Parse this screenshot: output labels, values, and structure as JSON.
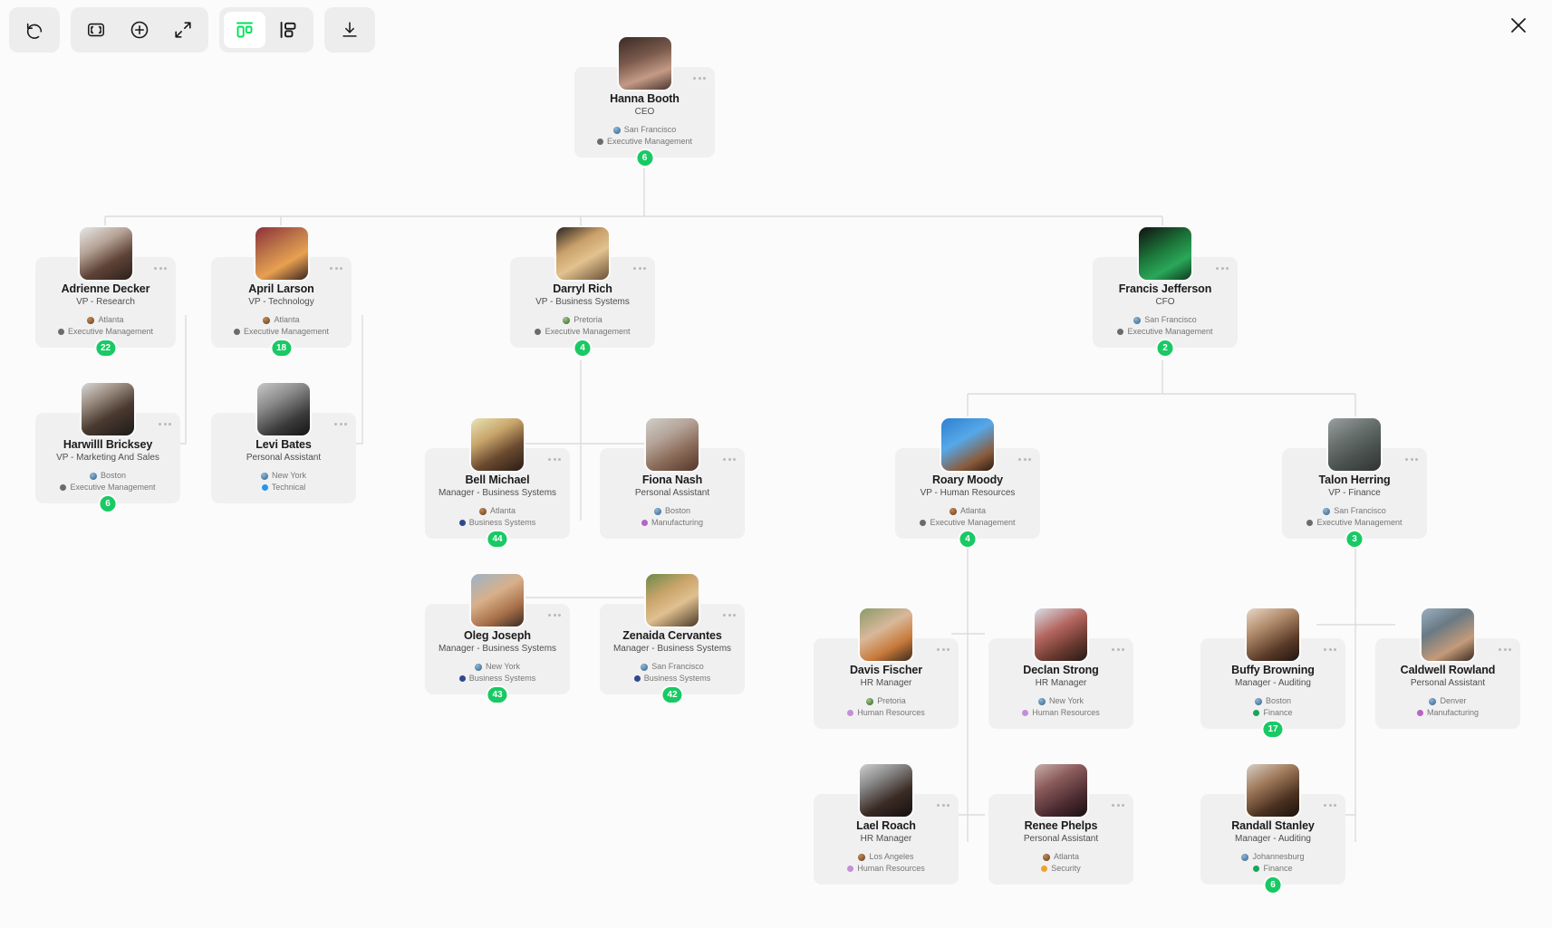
{
  "toolbar": {
    "buttons": [
      {
        "name": "undo-button",
        "icon": "undo-icon",
        "label": "Undo"
      },
      {
        "name": "fit-to-screen-button",
        "icon": "fit-screen-icon",
        "label": "Fit to screen"
      },
      {
        "name": "zoom-in-button",
        "icon": "plus-circle-icon",
        "label": "Zoom in"
      },
      {
        "name": "expand-button",
        "icon": "expand-arrows-icon",
        "label": "Expand"
      },
      {
        "name": "layout-vertical-button",
        "icon": "layout-vertical-icon",
        "label": "Vertical layout",
        "active": true
      },
      {
        "name": "layout-horizontal-button",
        "icon": "layout-horizontal-icon",
        "label": "Horizontal layout",
        "active": false
      },
      {
        "name": "export-button",
        "icon": "download-icon",
        "label": "Export"
      }
    ],
    "close_label": "Close",
    "active_color": "#00e05a"
  },
  "chart": {
    "badge_color": "#18c964",
    "card_bg": "#f0f0f0",
    "canvas_bg": "#fbfbfb"
  },
  "nodes": [
    {
      "id": "hanna-booth",
      "name": "Hanna Booth",
      "title": "CEO",
      "location": "San Francisco",
      "department": "Executive Management",
      "dept_color": "#6b6b6b",
      "globe": "blue",
      "badge": "6",
      "avatar": "linear-gradient(160deg,#3a2a26 0%,#7a5a4c 40%,#c49a86 70%,#4a3530 100%)"
    },
    {
      "id": "adrienne-decker",
      "name": "Adrienne Decker",
      "title": "VP - Research",
      "location": "Atlanta",
      "department": "Executive Management",
      "dept_color": "#6b6b6b",
      "globe": "amber",
      "badge": "22",
      "avatar": "linear-gradient(150deg,#e8e8e8 0%,#b5a296 35%,#5e4236 65%,#2a201c 100%)"
    },
    {
      "id": "april-larson",
      "name": "April Larson",
      "title": "VP - Technology",
      "location": "Atlanta",
      "department": "Executive Management",
      "dept_color": "#6b6b6b",
      "globe": "amber",
      "badge": "18",
      "avatar": "linear-gradient(150deg,#8d2f3a 0%,#c07a4a 40%,#e8a050 65%,#3a2420 100%)"
    },
    {
      "id": "darryl-rich",
      "name": "Darryl Rich",
      "title": "VP - Business Systems",
      "location": "Pretoria",
      "department": "Executive Management",
      "dept_color": "#6b6b6b",
      "globe": "green",
      "badge": "4",
      "avatar": "linear-gradient(150deg,#2a2420 0%,#c9a06a 35%,#e2c28e 60%,#6a5038 100%)"
    },
    {
      "id": "francis-jefferson",
      "name": "Francis Jefferson",
      "title": "CFO",
      "location": "San Francisco",
      "department": "Executive Management",
      "dept_color": "#6b6b6b",
      "globe": "blue",
      "badge": "2",
      "avatar": "linear-gradient(150deg,#111111 0%,#1d7a3c 45%,#2aa75a 70%,#0d3a1c 100%)"
    },
    {
      "id": "harwilll-bricksey",
      "name": "Harwilll Bricksey",
      "title": "VP - Marketing And Sales",
      "location": "Boston",
      "department": "Executive Management",
      "dept_color": "#6b6b6b",
      "globe": "blue",
      "badge": "6",
      "avatar": "linear-gradient(150deg,#d8d8d8 0%,#9a8c80 30%,#4a3a30 60%,#1c1a18 100%)"
    },
    {
      "id": "levi-bates",
      "name": "Levi Bates",
      "title": "Personal Assistant",
      "location": "New York",
      "department": "Technical",
      "dept_color": "#2196f3",
      "globe": "blue",
      "badge": null,
      "avatar": "linear-gradient(150deg,#c8c8c8 0%,#8a8a8a 35%,#3a3a3a 70%,#141414 100%)"
    },
    {
      "id": "bell-michael",
      "name": "Bell Michael",
      "title": "Manager - Business Systems",
      "location": "Atlanta",
      "department": "Business Systems",
      "dept_color": "#2f4a8c",
      "globe": "amber",
      "badge": "44",
      "avatar": "linear-gradient(150deg,#e8e4b8 0%,#c8a46a 35%,#6a4a30 65%,#2a1c14 100%)"
    },
    {
      "id": "fiona-nash",
      "name": "Fiona Nash",
      "title": "Personal Assistant",
      "location": "Boston",
      "department": "Manufacturing",
      "dept_color": "#b663c8",
      "globe": "blue",
      "badge": null,
      "avatar": "linear-gradient(150deg,#d0cfc9 0%,#b4a398 35%,#8a6a58 65%,#53372c 100%)"
    },
    {
      "id": "oleg-joseph",
      "name": "Oleg Joseph",
      "title": "Manager - Business Systems",
      "location": "New York",
      "department": "Business Systems",
      "dept_color": "#2f4a8c",
      "globe": "blue",
      "badge": "43",
      "avatar": "linear-gradient(150deg,#9ab4c8 0%,#d8b08a 40%,#a8714a 70%,#3a2a20 100%)"
    },
    {
      "id": "zenaida-cervantes",
      "name": "Zenaida Cervantes",
      "title": "Manager - Business Systems",
      "location": "San Francisco",
      "department": "Business Systems",
      "dept_color": "#2f4a8c",
      "globe": "blue",
      "badge": "42",
      "avatar": "linear-gradient(150deg,#6a8a4a 0%,#c9a46a 35%,#e0c090 60%,#4a3a28 100%)"
    },
    {
      "id": "roary-moody",
      "name": "Roary Moody",
      "title": "VP - Human Resources",
      "location": "Atlanta",
      "department": "Executive Management",
      "dept_color": "#6b6b6b",
      "globe": "amber",
      "badge": "4",
      "avatar": "linear-gradient(150deg,#2f7fd0 0%,#56a8e8 40%,#8a5a3a 75%,#2a1c14 100%)"
    },
    {
      "id": "talon-herring",
      "name": "Talon Herring",
      "title": "VP - Finance",
      "location": "San Francisco",
      "department": "Executive Management",
      "dept_color": "#6b6b6b",
      "globe": "blue",
      "badge": "3",
      "avatar": "linear-gradient(150deg,#9aa0a0 0%,#6a7270 35%,#4a5250 65%,#30342f 100%)"
    },
    {
      "id": "davis-fischer",
      "name": "Davis Fischer",
      "title": "HR Manager",
      "location": "Pretoria",
      "department": "Human Resources",
      "dept_color": "#c38fd8",
      "globe": "green",
      "badge": null,
      "avatar": "linear-gradient(150deg,#8a9a6a 0%,#d8b89a 40%,#c87a3a 70%,#3a2a1c 100%)"
    },
    {
      "id": "declan-strong",
      "name": "Declan Strong",
      "title": "HR Manager",
      "location": "New York",
      "department": "Human Resources",
      "dept_color": "#c38fd8",
      "globe": "blue",
      "badge": null,
      "avatar": "linear-gradient(150deg,#d8e0e8 0%,#b4655f 40%,#6a3a30 70%,#241a16 100%)"
    },
    {
      "id": "buffy-browning",
      "name": "Buffy Browning",
      "title": "Manager - Auditing",
      "location": "Boston",
      "department": "Finance",
      "dept_color": "#18a558",
      "globe": "blue",
      "badge": "17",
      "avatar": "linear-gradient(150deg,#e8d8c8 0%,#b08a6a 35%,#5a3a28 70%,#201410 100%)"
    },
    {
      "id": "caldwell-rowland",
      "name": "Caldwell Rowland",
      "title": "Personal Assistant",
      "location": "Denver",
      "department": "Manufacturing",
      "dept_color": "#b663c8",
      "globe": "blue",
      "badge": null,
      "avatar": "linear-gradient(150deg,#9ab0c0 0%,#6a7a84 35%,#c49a7a 70%,#3a2a20 100%)"
    },
    {
      "id": "lael-roach",
      "name": "Lael Roach",
      "title": "HR Manager",
      "location": "Los Angeles",
      "department": "Human Resources",
      "dept_color": "#c38fd8",
      "globe": "amber",
      "badge": null,
      "avatar": "linear-gradient(150deg,#cfcfcf 0%,#8a8a8a 30%,#3a2a24 65%,#141010 100%)"
    },
    {
      "id": "renee-phelps",
      "name": "Renee Phelps",
      "title": "Personal Assistant",
      "location": "Atlanta",
      "department": "Security",
      "dept_color": "#f0a030",
      "globe": "amber",
      "badge": null,
      "avatar": "linear-gradient(150deg,#c8b0a8 0%,#8a5a5a 35%,#4a2a30 70%,#1a1014 100%)"
    },
    {
      "id": "randall-stanley",
      "name": "Randall Stanley",
      "title": "Manager - Auditing",
      "location": "Johannesburg",
      "department": "Finance",
      "dept_color": "#18a558",
      "globe": "blue",
      "badge": "6",
      "avatar": "linear-gradient(150deg,#d8d0c8 0%,#a07a5a 35%,#4a3020 70%,#1a120c 100%)"
    }
  ]
}
